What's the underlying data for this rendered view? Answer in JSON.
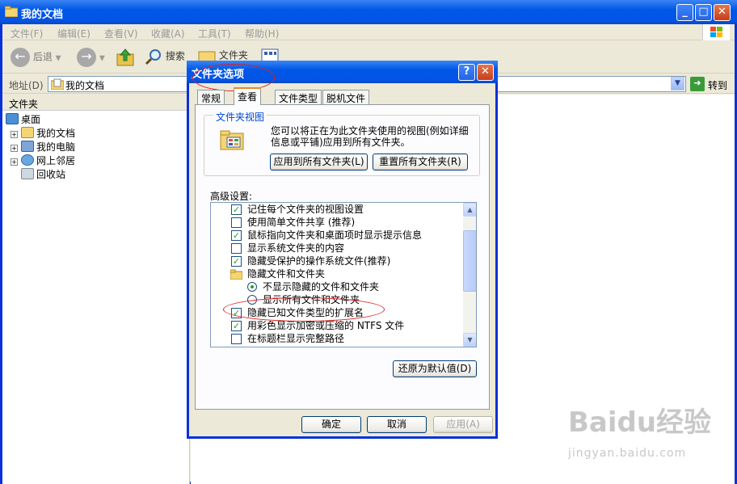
{
  "window": {
    "title": "我的文档",
    "menu": [
      "文件(F)",
      "编辑(E)",
      "查看(V)",
      "收藏(A)",
      "工具(T)",
      "帮助(H)"
    ],
    "toolbar": {
      "back": "后退",
      "search": "搜索",
      "folders": "文件夹"
    },
    "address": {
      "label": "地址(D)",
      "value": "我的文档",
      "go": "转到"
    },
    "folder_pane": {
      "header": "文件夹",
      "items": [
        {
          "label": "桌面",
          "icon": "desktop-icon"
        },
        {
          "label": "我的文档",
          "icon": "my-documents-icon"
        },
        {
          "label": "我的电脑",
          "icon": "my-computer-icon"
        },
        {
          "label": "网上邻居",
          "icon": "network-icon"
        },
        {
          "label": "回收站",
          "icon": "recycle-bin-icon"
        }
      ]
    },
    "watermark": {
      "main": "Baidu经验",
      "sub": "jingyan.baidu.com"
    }
  },
  "dialog": {
    "title": "文件夹选项",
    "tabs": [
      "常规",
      "查看",
      "文件类型",
      "脱机文件"
    ],
    "selected_tab": "查看",
    "folder_views": {
      "group_label": "文件夹视图",
      "description": "您可以将正在为此文件夹使用的视图(例如详细信息或平铺)应用到所有文件夹。",
      "apply_all": "应用到所有文件夹(L)",
      "reset_all": "重置所有文件夹(R)"
    },
    "advanced_label": "高级设置:",
    "settings": [
      {
        "type": "checkbox",
        "checked": true,
        "label": "记住每个文件夹的视图设置"
      },
      {
        "type": "checkbox",
        "checked": false,
        "label": "使用简单文件共享 (推荐)"
      },
      {
        "type": "checkbox",
        "checked": true,
        "label": "鼠标指向文件夹和桌面项时显示提示信息"
      },
      {
        "type": "checkbox",
        "checked": false,
        "label": "显示系统文件夹的内容"
      },
      {
        "type": "checkbox",
        "checked": true,
        "label": "隐藏受保护的操作系统文件(推荐)"
      },
      {
        "type": "folder",
        "label": "隐藏文件和文件夹"
      },
      {
        "type": "radio",
        "checked": true,
        "label": "不显示隐藏的文件和文件夹"
      },
      {
        "type": "radio",
        "checked": false,
        "label": "显示所有文件和文件夹"
      },
      {
        "type": "checkbox",
        "checked": true,
        "label": "隐藏已知文件类型的扩展名"
      },
      {
        "type": "checkbox",
        "checked": true,
        "label": "用彩色显示加密或压缩的 NTFS 文件"
      },
      {
        "type": "checkbox",
        "checked": false,
        "label": "在标题栏显示完整路径"
      }
    ],
    "restore_defaults": "还原为默认值(D)",
    "ok": "确定",
    "cancel": "取消",
    "apply": "应用(A)"
  }
}
